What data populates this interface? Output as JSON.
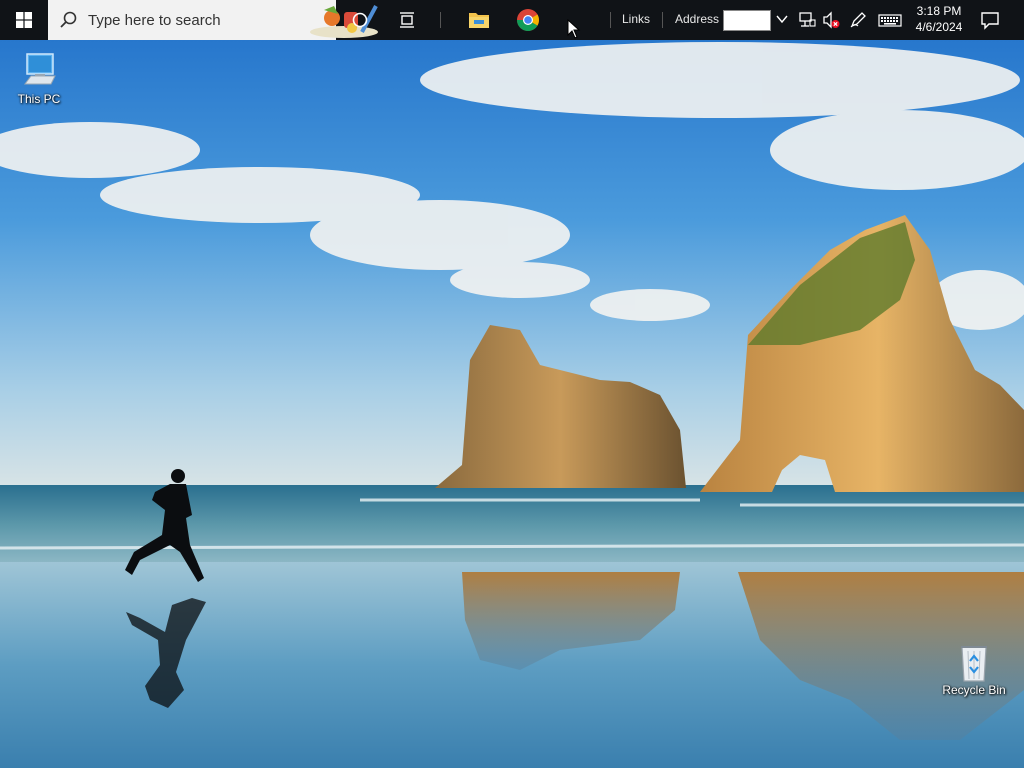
{
  "taskbar": {
    "search_placeholder": "Type here to search",
    "links_label": "Links",
    "address_label": "Address",
    "address_value": "",
    "clock": {
      "time": "3:18 PM",
      "date": "4/6/2024"
    },
    "pinned": [
      "file-explorer",
      "google-chrome"
    ],
    "tray_icons": [
      "network-icon",
      "volume-muted-icon",
      "pen-icon",
      "keyboard-icon"
    ],
    "background": "#101317"
  },
  "desktop": {
    "icons": [
      {
        "label": "This PC",
        "icon": "computer-icon"
      },
      {
        "label": "Recycle Bin",
        "icon": "recycle-bin-icon"
      }
    ]
  }
}
